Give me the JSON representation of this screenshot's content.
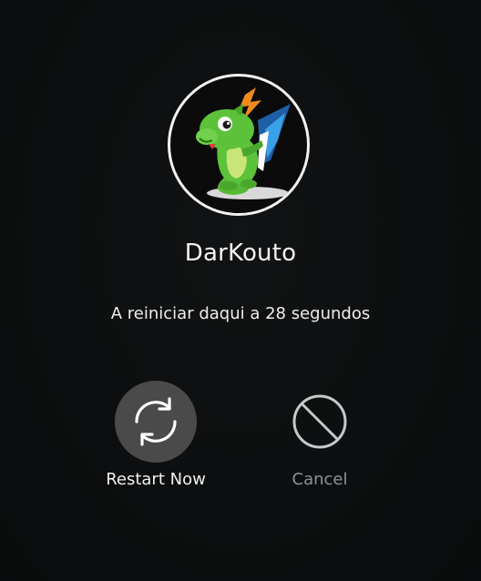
{
  "user": {
    "name": "DarKouto",
    "avatar_icon": "konqi-dragon-avatar"
  },
  "message": "A reiniciar daqui a 28 segundos",
  "actions": [
    {
      "label": "Restart Now",
      "icon": "restart-icon",
      "selected": true
    },
    {
      "label": "Cancel",
      "icon": "cancel-icon",
      "selected": false
    }
  ],
  "colors": {
    "background": "#0d0f10",
    "avatar_border": "#f2f2f2",
    "selected_button_bg": "#4a4a4a",
    "cancel_label": "#8e9091",
    "dragon_green": "#5cc23a",
    "accent_blue": "#3aa0e8",
    "accent_orange": "#f08a1c"
  }
}
